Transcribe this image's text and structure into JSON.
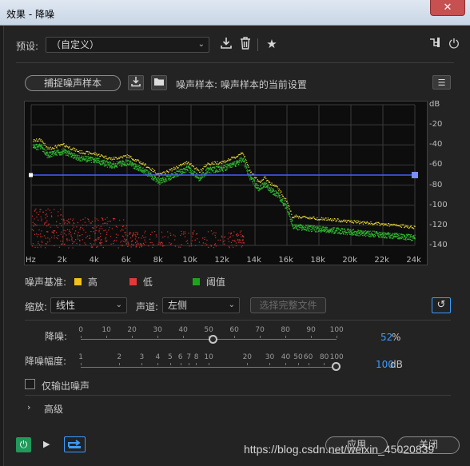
{
  "window": {
    "title": "效果 - 降噪",
    "close": "✕"
  },
  "preset": {
    "label": "预设:",
    "value": "（自定义）",
    "icons": [
      "download-icon",
      "trash-icon",
      "star-icon"
    ]
  },
  "capture": {
    "button": "捕捉噪声样本",
    "sample_text": "噪声样本: 噪声样本的当前设置"
  },
  "graph": {
    "y_ticks": [
      "dB",
      "-20",
      "-40",
      "-60",
      "-80",
      "-100",
      "-120",
      "-140"
    ],
    "x_ticks": [
      "Hz",
      "2k",
      "4k",
      "6k",
      "8k",
      "10k",
      "12k",
      "14k",
      "16k",
      "18k",
      "20k",
      "22k",
      "24k"
    ],
    "threshold_db": -70,
    "colors": {
      "high": "#e8d93a",
      "low": "#d23030",
      "threshold": "#2fb82f",
      "line": "#4a5cff"
    }
  },
  "legend": {
    "label": "噪声基准:",
    "items": [
      {
        "label": "高",
        "color": "#f2c21b"
      },
      {
        "label": "低",
        "color": "#e03a3a"
      },
      {
        "label": "阈值",
        "color": "#1fa31f"
      }
    ]
  },
  "scale": {
    "label": "缩放:",
    "value": "线性"
  },
  "channel": {
    "label": "声道:",
    "value": "左侧"
  },
  "select_file_button": "选择完整文件",
  "reduction": {
    "label": "降噪:",
    "ticks": [
      "0",
      "10",
      "20",
      "30",
      "40",
      "50",
      "60",
      "70",
      "80",
      "90",
      "100"
    ],
    "value": "52",
    "unit": "%",
    "level": 0.52
  },
  "reduce_by": {
    "label": "降噪幅度:",
    "ticks": [
      "1",
      "2",
      "3",
      "4",
      "5",
      "6",
      "7",
      "8",
      "10",
      "20",
      "30",
      "40",
      "50",
      "60",
      "80",
      "100"
    ],
    "value": "100",
    "unit": "dB",
    "level": 1.0
  },
  "output_noise_only": "仅输出噪声",
  "advanced": "高级",
  "footer": {
    "apply": "应用",
    "close": "关闭"
  },
  "watermark": "https://blog.csdn.net/weixin_45020839"
}
